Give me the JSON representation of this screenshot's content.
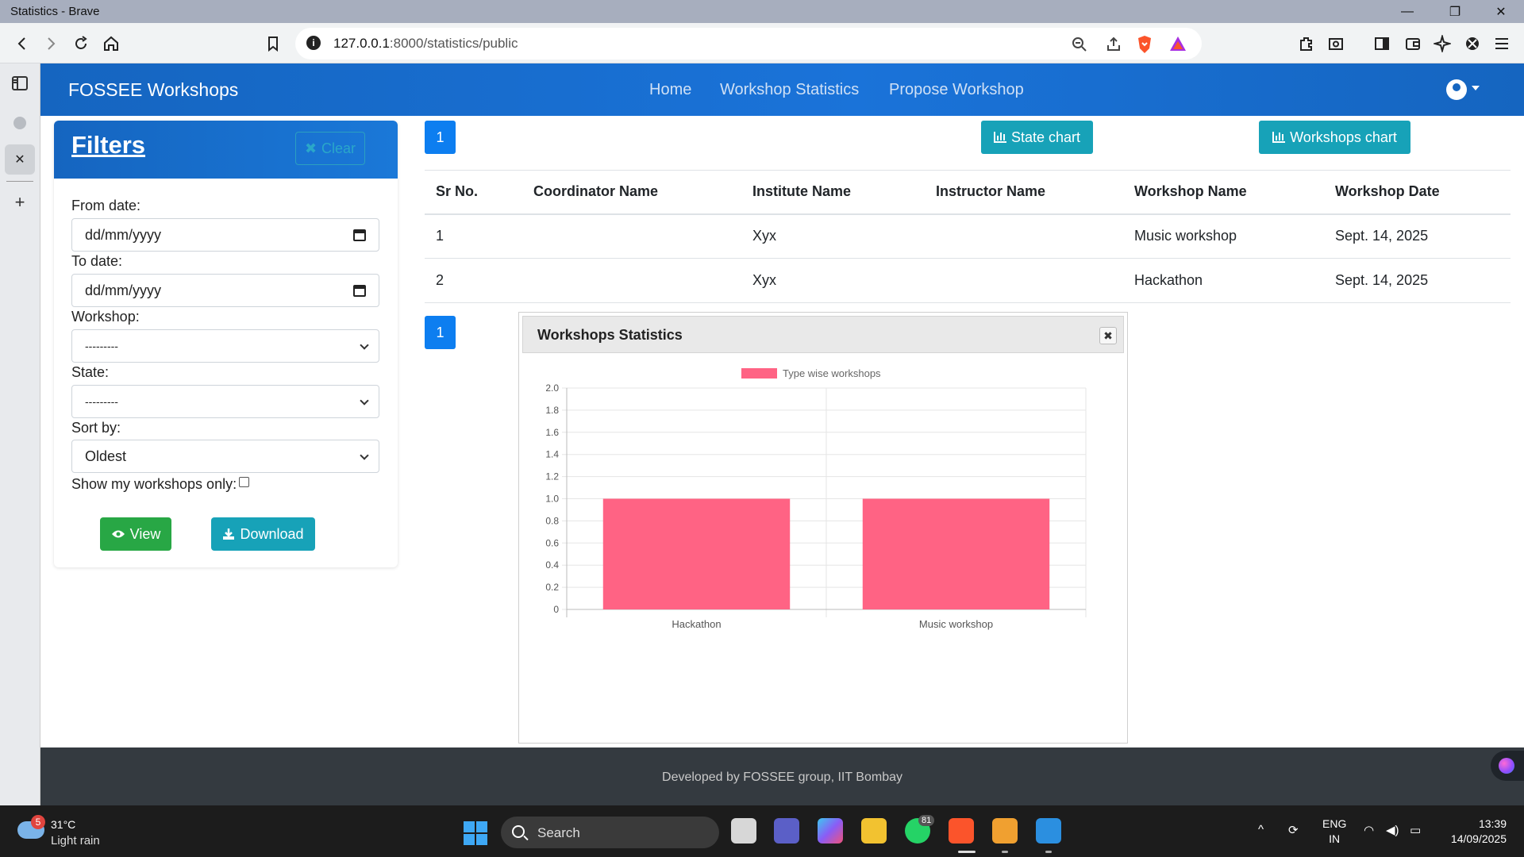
{
  "window": {
    "title": "Statistics - Brave",
    "minimize": "—",
    "restore": "❐",
    "close": "✕"
  },
  "browser": {
    "url_host": "127.0.0.1",
    "url_path": ":8000/statistics/public"
  },
  "navbar": {
    "brand": "FOSSEE Workshops",
    "links": [
      "Home",
      "Workshop Statistics",
      "Propose Workshop"
    ]
  },
  "filters": {
    "title": "Filters",
    "clear_label": "Clear",
    "from_date_label": "From date:",
    "from_date_placeholder": "dd/mm/yyyy",
    "to_date_label": "To date:",
    "to_date_placeholder": "dd/mm/yyyy",
    "workshop_label": "Workshop:",
    "workshop_value": "---------",
    "state_label": "State:",
    "state_value": "---------",
    "sort_label": "Sort by:",
    "sort_value": "Oldest",
    "show_mine_label": "Show my workshops only:",
    "view_label": "View",
    "download_label": "Download"
  },
  "main": {
    "page_number": "1",
    "state_chart_label": "State chart",
    "workshops_chart_label": "Workshops chart",
    "table": {
      "headers": [
        "Sr No.",
        "Coordinator Name",
        "Institute Name",
        "Instructor Name",
        "Workshop Name",
        "Workshop Date"
      ],
      "rows": [
        [
          "1",
          "",
          "Xyx",
          "",
          "Music workshop",
          "Sept. 14, 2025"
        ],
        [
          "2",
          "",
          "Xyx",
          "",
          "Hackathon",
          "Sept. 14, 2025"
        ]
      ]
    }
  },
  "modal": {
    "title": "Workshops Statistics",
    "close_symbol": "✖"
  },
  "chart_data": {
    "type": "bar",
    "categories": [
      "Hackathon",
      "Music workshop"
    ],
    "series": [
      {
        "name": "Type wise workshops",
        "values": [
          1,
          1
        ],
        "color": "#ff6384"
      }
    ],
    "ylim": [
      0,
      2.0
    ],
    "yticks": [
      "0",
      "0.2",
      "0.4",
      "0.6",
      "0.8",
      "1.0",
      "1.2",
      "1.4",
      "1.6",
      "1.8",
      "2.0"
    ],
    "grid": true,
    "legend_position": "top"
  },
  "footer": {
    "text": "Developed by FOSSEE group, IIT Bombay"
  },
  "taskbar": {
    "weather_badge": "5",
    "temperature": "31°C",
    "weather": "Light rain",
    "search_label": "Search",
    "whatsapp_badge": "81",
    "lang_line1": "ENG",
    "lang_line2": "IN",
    "time": "13:39",
    "date": "14/09/2025"
  },
  "colors": {
    "navbar": "#1565c0",
    "accent_info": "#17a2b8",
    "success": "#28a745",
    "primary": "#0d7ef0",
    "bar": "#ff6384"
  }
}
